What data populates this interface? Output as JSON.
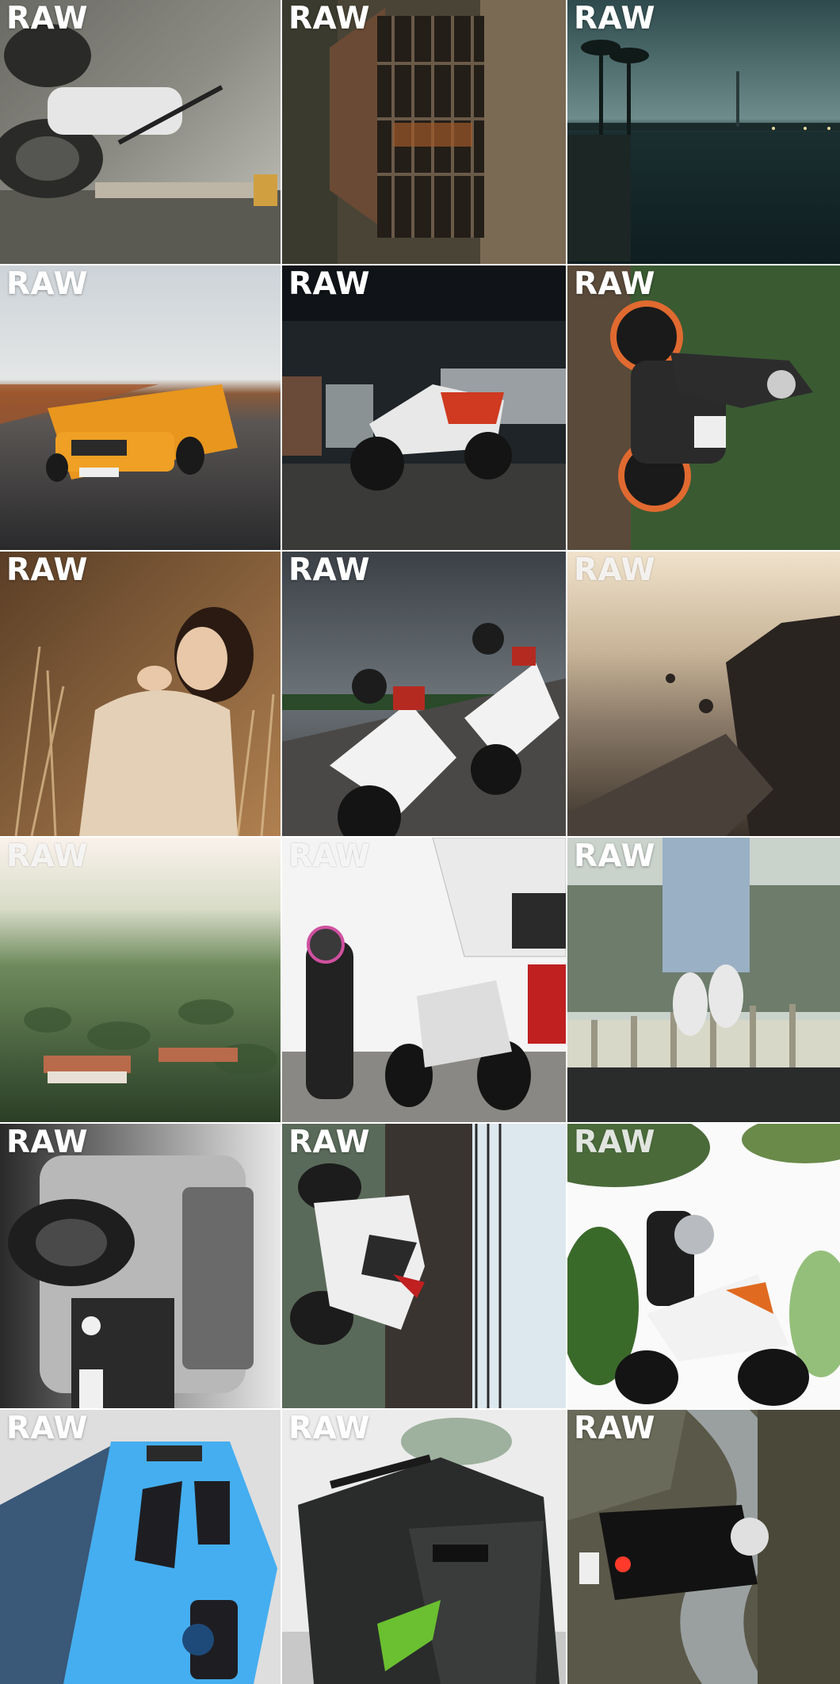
{
  "label": "RAW",
  "tiles": [
    {
      "subject": "motorcycle",
      "colors": [
        "#4a4a46",
        "#8a8a82",
        "#d8d8d2"
      ]
    },
    {
      "subject": "overgrown gate",
      "colors": [
        "#2b2a24",
        "#6b5a46",
        "#8a7a62"
      ]
    },
    {
      "subject": "lake at dusk",
      "colors": [
        "#1d3438",
        "#3b5b5e",
        "#6b8a8c"
      ]
    },
    {
      "subject": "orange sports car",
      "colors": [
        "#c9d0d6",
        "#e08a20",
        "#3a3a3c"
      ]
    },
    {
      "subject": "motorcycle in parking garage",
      "colors": [
        "#1f2428",
        "#d23a22",
        "#e8e8e8"
      ]
    },
    {
      "subject": "rider hanging from motorcycle",
      "colors": [
        "#2f4a2a",
        "#e06a30",
        "#121212"
      ]
    },
    {
      "subject": "woman in field",
      "colors": [
        "#6a4a2c",
        "#c8a27c",
        "#e9d8c4"
      ]
    },
    {
      "subject": "two riders on superbikes",
      "colors": [
        "#3a4248",
        "#ffffff",
        "#b52a20"
      ]
    },
    {
      "subject": "coastline at sunset",
      "colors": [
        "#e8d8c0",
        "#7a6a5a",
        "#2a2420"
      ]
    },
    {
      "subject": "tea plantation",
      "colors": [
        "#f6ede6",
        "#5e7a4e",
        "#2e4428"
      ]
    },
    {
      "subject": "rider with naked bike",
      "colors": [
        "#ffffff",
        "#2a2a2a",
        "#c02020"
      ]
    },
    {
      "subject": "floating sneakers",
      "colors": [
        "#d6dcda",
        "#9ab0c4",
        "#2e3a32"
      ]
    },
    {
      "subject": "off-road vehicle",
      "colors": [
        "#e8e8e8",
        "#6a6a6a",
        "#1e1e1e"
      ]
    },
    {
      "subject": "sport bike upside down",
      "colors": [
        "#dbe8ee",
        "#2c2a28",
        "#ffffff"
      ]
    },
    {
      "subject": "rider on orange motorcycle",
      "colors": [
        "#ffffff",
        "#3a6a2a",
        "#e06a20"
      ]
    },
    {
      "subject": "blue car",
      "colors": [
        "#e6e6e6",
        "#3aa4e8",
        "#1e4a7a"
      ]
    },
    {
      "subject": "dark motorcycle",
      "colors": [
        "#e8eae8",
        "#2a2c2c",
        "#6ac030"
      ]
    },
    {
      "subject": "rider on winding road",
      "colors": [
        "#5a5848",
        "#9aa0a0",
        "#1a1a1a"
      ]
    }
  ]
}
